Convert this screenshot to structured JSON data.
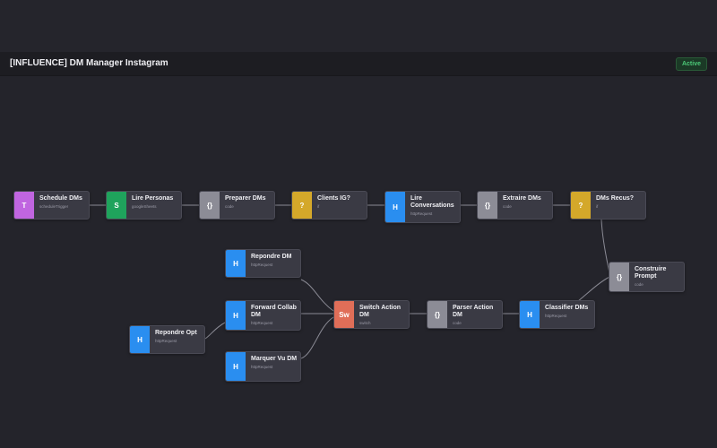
{
  "app": {
    "workflow_title": "[INFLUENCE] DM Manager Instagram",
    "status": "Active"
  },
  "colors": {
    "trigger": "#c065e0",
    "sheets": "#1fa35c",
    "code": "#8c8c96",
    "if": "#d4a82a",
    "http": "#2a8ef0",
    "switch": "#e06e58"
  },
  "nodes": [
    {
      "id": "schedule",
      "badge": "T",
      "label": "Schedule DMs",
      "type": "scheduleTrigger",
      "color": "trigger"
    },
    {
      "id": "personas",
      "badge": "S",
      "label": "Lire Personas",
      "type": "googleSheets",
      "color": "sheets"
    },
    {
      "id": "preparer",
      "badge": "{}",
      "label": "Preparer DMs",
      "type": "code",
      "color": "code"
    },
    {
      "id": "clients",
      "badge": "?",
      "label": "Clients IG?",
      "type": "if",
      "color": "if"
    },
    {
      "id": "lireconv",
      "badge": "H",
      "label": "Lire Conversations",
      "type": "httpRequest",
      "color": "http"
    },
    {
      "id": "extraire",
      "badge": "{}",
      "label": "Extraire DMs",
      "type": "code",
      "color": "code"
    },
    {
      "id": "recus",
      "badge": "?",
      "label": "DMs Recus?",
      "type": "if",
      "color": "if"
    },
    {
      "id": "construire",
      "badge": "{}",
      "label": "Construire Prompt",
      "type": "code",
      "color": "code"
    },
    {
      "id": "classifier",
      "badge": "H",
      "label": "Classifier DMs",
      "type": "httpRequest",
      "color": "http"
    },
    {
      "id": "parser",
      "badge": "{}",
      "label": "Parser Action DM",
      "type": "code",
      "color": "code"
    },
    {
      "id": "switch",
      "badge": "Sw",
      "label": "Switch Action DM",
      "type": "switch",
      "color": "switch"
    },
    {
      "id": "repondre",
      "badge": "H",
      "label": "Repondre DM",
      "type": "httpRequest",
      "color": "http"
    },
    {
      "id": "forward",
      "badge": "H",
      "label": "Forward Collab DM",
      "type": "httpRequest",
      "color": "http"
    },
    {
      "id": "marquer",
      "badge": "H",
      "label": "Marquer Vu DM",
      "type": "httpRequest",
      "color": "http"
    },
    {
      "id": "repondreopt",
      "badge": "H",
      "label": "Repondre Opt",
      "type": "httpRequest",
      "color": "http"
    }
  ]
}
